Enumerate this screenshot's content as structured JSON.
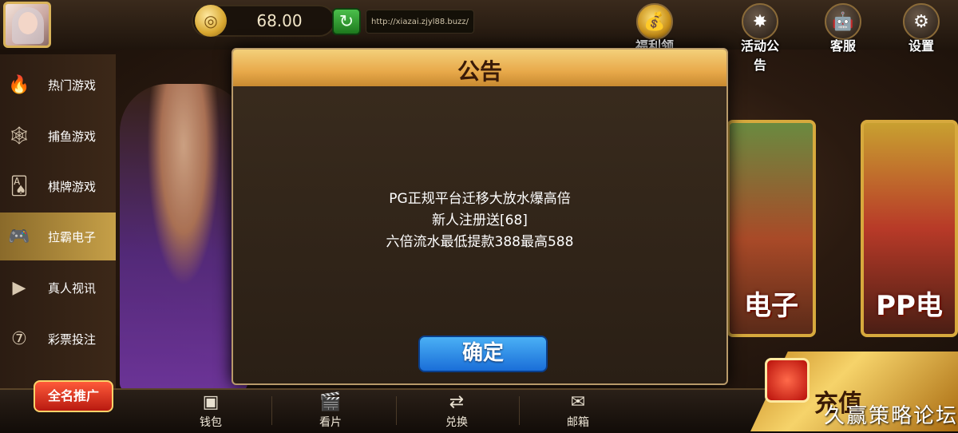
{
  "header": {
    "balance": "68.00",
    "url": "http://xiazai.zjyl88.buzz/",
    "icons": [
      {
        "label": "福利领取",
        "icon": "gift-money-icon"
      },
      {
        "label": "活动公告",
        "icon": "announcement-icon"
      },
      {
        "label": "客服",
        "icon": "customer-service-icon"
      },
      {
        "label": "设置",
        "icon": "settings-icon"
      }
    ]
  },
  "sidebar": {
    "items": [
      {
        "label": "热门游戏",
        "icon": "flame-icon",
        "glyph": "🔥"
      },
      {
        "label": "捕鱼游戏",
        "icon": "net-icon",
        "glyph": "🕸"
      },
      {
        "label": "棋牌游戏",
        "icon": "cards-icon",
        "glyph": "🂡"
      },
      {
        "label": "拉霸电子",
        "icon": "gamepad-icon",
        "glyph": "🎮"
      },
      {
        "label": "真人视讯",
        "icon": "video-icon",
        "glyph": "▶"
      },
      {
        "label": "彩票投注",
        "icon": "lottery-icon",
        "glyph": "⑦"
      }
    ],
    "active_index": 3
  },
  "games": {
    "card_a_title": "电子",
    "card_b_title": "PP电"
  },
  "dialog": {
    "title": "公告",
    "lines": [
      "PG正规平台迁移大放水爆高倍",
      "新人注册送[68]",
      "六倍流水最低提款388最高588"
    ],
    "confirm_label": "确定"
  },
  "footer": {
    "promo_label": "全名推广",
    "buttons": [
      {
        "label": "钱包",
        "icon": "wallet-icon"
      },
      {
        "label": "看片",
        "icon": "clapperboard-icon"
      },
      {
        "label": "兑换",
        "icon": "exchange-icon"
      },
      {
        "label": "邮箱",
        "icon": "mailbox-icon"
      }
    ],
    "recharge_label": "充值",
    "watermark": "久赢策略论坛"
  }
}
